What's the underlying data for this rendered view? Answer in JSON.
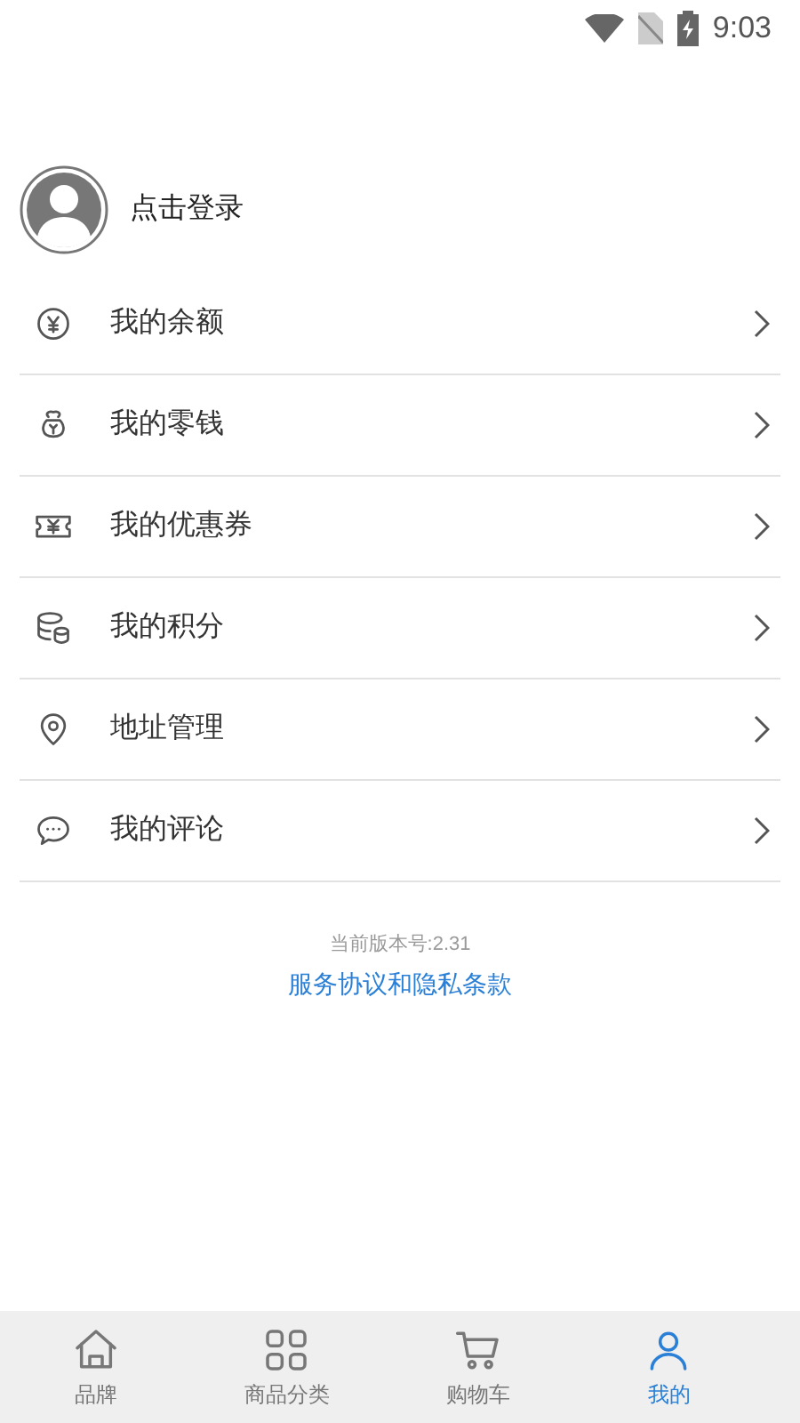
{
  "status_bar": {
    "time": "9:03"
  },
  "profile": {
    "login_text": "点击登录"
  },
  "menu": [
    {
      "kind": "balance",
      "label": "我的余额"
    },
    {
      "kind": "change",
      "label": "我的零钱"
    },
    {
      "kind": "coupon",
      "label": "我的优惠券"
    },
    {
      "kind": "points",
      "label": "我的积分"
    },
    {
      "kind": "address",
      "label": "地址管理"
    },
    {
      "kind": "comment",
      "label": "我的评论"
    }
  ],
  "footer": {
    "version": "当前版本号:2.31",
    "link": "服务协议和隐私条款"
  },
  "tab_bar": [
    {
      "kind": "home",
      "label": "品牌",
      "selected": false
    },
    {
      "kind": "grid",
      "label": "商品分类",
      "selected": false
    },
    {
      "kind": "cart",
      "label": "购物车",
      "selected": false
    },
    {
      "kind": "person",
      "label": "我的",
      "selected": true
    }
  ]
}
